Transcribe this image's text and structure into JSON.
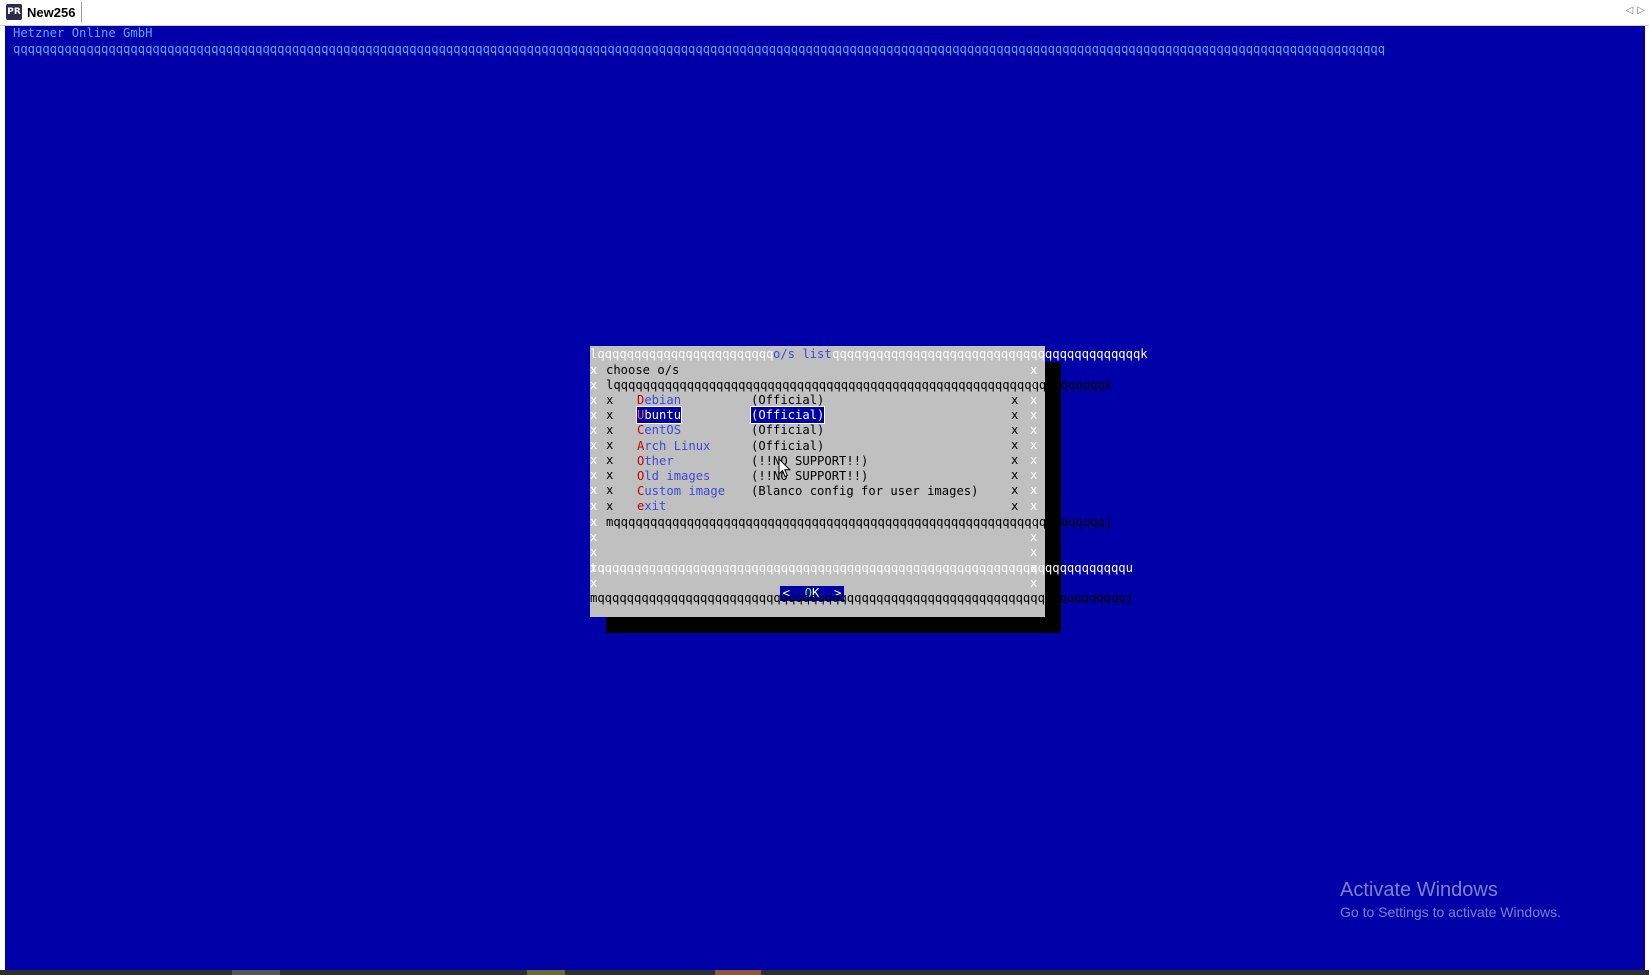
{
  "window": {
    "tab_title": "New256",
    "tab_icon_glyph": "PR",
    "nav_prev": "◁",
    "nav_next": "▷"
  },
  "terminal": {
    "header": "Hetzner Online GmbH",
    "rule": "qqqqqqqqqqqqqqqqqqqqqqqqqqqqqqqqqqqqqqqqqqqqqqqqqqqqqqqqqqqqqqqqqqqqqqqqqqqqqqqqqqqqqqqqqqqqqqqqqqqqqqqqqqqqqqqqqqqqqqqqqqqqqqqqqqqqqqqqqqqqqqqqqqqqqqqqqqqqqqqqqqqqqqqqqqqqqqqqqqqqqqqqqqq",
    "background_color": "#0000a8"
  },
  "dialog": {
    "title": "o/s list",
    "prompt": "choose o/s",
    "border_top": "lqqqqqqqqqqqqqqqqqqqqqqqqqqqqqqqqqqqqqqqqqqqqqqqqqqqqqqqqqqqqqqqqqqqqqqqqqqk",
    "inner_top": "lqqqqqqqqqqqqqqqqqqqqqqqqqqqqqqqqqqqqqqqqqqqqqqqqqqqqqqqqqqqqqqqqqqqk",
    "inner_bottom": "mqqqqqqqqqqqqqqqqqqqqqqqqqqqqqqqqqqqqqqqqqqqqqqqqqqqqqqqqqqqqqqqqqqqj",
    "separator": "tqqqqqqqqqqqqqqqqqqqqqqqqqqqqqqqqqqqqqqqqqqqqqqqqqqqqqqqqqqqqqqqqqqqqqqqqu",
    "border_bottom": "mqqqqqqqqqqqqqqqqqqqqqqqqqqqqqqqqqqqqqqqqqqqqqqqqqqqqqqqqqqqqqqqqqqqqqqqqj",
    "side_char": "x",
    "items": [
      {
        "hot": "D",
        "rest": "ebian",
        "desc": "(Official)",
        "selected": false
      },
      {
        "hot": "U",
        "rest": "buntu",
        "desc": "(Official)",
        "selected": true
      },
      {
        "hot": "C",
        "rest": "entOS",
        "desc": "(Official)",
        "selected": false
      },
      {
        "hot": "A",
        "rest": "rch Linux",
        "desc": "(Official)",
        "selected": false
      },
      {
        "hot": "O",
        "rest": "ther",
        "desc": "(!!NO SUPPORT!!)",
        "selected": false
      },
      {
        "hot": "O",
        "rest": "ld images",
        "desc": "(!!NO SUPPORT!!)",
        "selected": false
      },
      {
        "hot": "C",
        "rest": "ustom image",
        "desc": "(Blanco config for user images)",
        "selected": false
      },
      {
        "hot": "e",
        "rest": "xit",
        "desc": "",
        "selected": false
      }
    ],
    "ok_button": {
      "left": "<  ",
      "hot": "O",
      "rest": "K",
      "right": "  >"
    }
  },
  "watermark": {
    "title": "Activate Windows",
    "subtitle": "Go to Settings to activate Windows."
  },
  "colors": {
    "dialog_bg": "#c0c0c0",
    "hotkey": "#c80000",
    "tag": "#3b4bd8",
    "selection": "#0000a8"
  }
}
